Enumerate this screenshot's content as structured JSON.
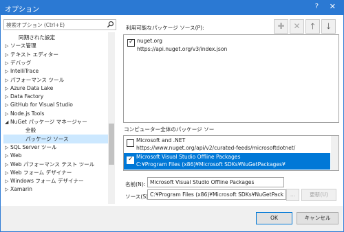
{
  "window": {
    "title": "オプション",
    "help": "?",
    "close": "✕"
  },
  "search": {
    "placeholder": "検索オプション (Ctrl+E)"
  },
  "tree": [
    {
      "label": "同期された設定",
      "arrow": ""
    },
    {
      "label": "ソース管理",
      "arrow": "▷"
    },
    {
      "label": "テキスト エディター",
      "arrow": "▷"
    },
    {
      "label": "デバッグ",
      "arrow": "▷"
    },
    {
      "label": "IntelliTrace",
      "arrow": "▷"
    },
    {
      "label": "パフォーマンス ツール",
      "arrow": "▷"
    },
    {
      "label": "Azure Data Lake",
      "arrow": "▷"
    },
    {
      "label": "Data Factory",
      "arrow": "▷"
    },
    {
      "label": "GitHub for Visual Studio",
      "arrow": "▷"
    },
    {
      "label": "Node.js Tools",
      "arrow": "▷"
    },
    {
      "label": "NuGet パッケージ マネージャー",
      "arrow": "◢"
    },
    {
      "label": "全般",
      "arrow": ""
    },
    {
      "label": "パッケージ ソース",
      "arrow": ""
    },
    {
      "label": "SQL Server ツール",
      "arrow": "▷"
    },
    {
      "label": "Web",
      "arrow": "▷"
    },
    {
      "label": "Web パフォーマンス テスト ツール",
      "arrow": "▷"
    },
    {
      "label": "Web フォーム デザイナー",
      "arrow": "▷"
    },
    {
      "label": "Windows フォーム デザイナー",
      "arrow": "▷"
    },
    {
      "label": "Xamarin",
      "arrow": "▷"
    }
  ],
  "sources_label": "利用可能なパッケージ ソース(P):",
  "toolbar": {
    "add": "✚",
    "remove": "✕",
    "up": "🡑",
    "down": "🡓"
  },
  "available_sources": [
    {
      "name": "nuget.org",
      "url": "https://api.nuget.org/v3/index.json",
      "checked": true
    }
  ],
  "machine_label": "コンピューター全体のパッケージ ソー",
  "machine_sources": [
    {
      "name": "Microsoft and .NET",
      "url": "https://www.nuget.org/api/v2/curated-feeds/microsoftdotnet/",
      "checked": false
    },
    {
      "name": "Microsoft Visual Studio Offline Packages",
      "url": "C:¥Program Files (x86)¥Microsoft SDKs¥NuGetPackages¥",
      "checked": true
    }
  ],
  "name_label": "名前(N):",
  "name_value": "Microsoft Visual Studio Offline Packages",
  "source_label": "ソース(S):",
  "source_value": "C:¥Program Files (x86)¥Microsoft SDKs¥NuGetPack",
  "browse_label": "...",
  "update_label": "更新(U)",
  "ok_label": "OK",
  "cancel_label": "キャンセル",
  "colors": {
    "title_bar": "#2b79d3",
    "selection": "#0078d7",
    "tree_selection": "#cce8ff"
  }
}
